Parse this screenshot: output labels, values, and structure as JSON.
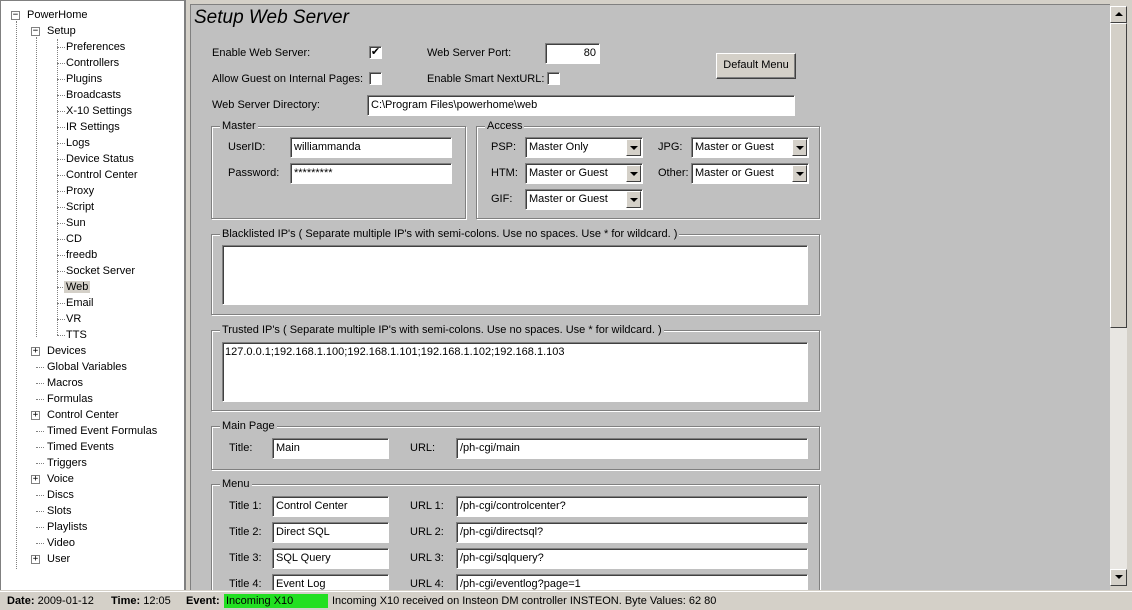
{
  "colors": {
    "event_badge": "#22e022",
    "window_bg": "#d4d0c8",
    "panel_bg": "#c0c0c0"
  },
  "tree": {
    "root": "PowerHome",
    "setup": "Setup",
    "setup_items": [
      "Preferences",
      "Controllers",
      "Plugins",
      "Broadcasts",
      "X-10 Settings",
      "IR Settings",
      "Logs",
      "Device Status",
      "Control Center",
      "Proxy",
      "Script",
      "Sun",
      "CD",
      "freedb",
      "Socket Server",
      "Web",
      "Email",
      "VR",
      "TTS"
    ],
    "selected": "Web",
    "top_items": [
      {
        "label": "Devices",
        "expandable": true
      },
      {
        "label": "Global Variables",
        "expandable": false
      },
      {
        "label": "Macros",
        "expandable": false
      },
      {
        "label": "Formulas",
        "expandable": false
      },
      {
        "label": "Control Center",
        "expandable": true
      },
      {
        "label": "Timed Event Formulas",
        "expandable": false
      },
      {
        "label": "Timed Events",
        "expandable": false
      },
      {
        "label": "Triggers",
        "expandable": false
      },
      {
        "label": "Voice",
        "expandable": true
      },
      {
        "label": "Discs",
        "expandable": false
      },
      {
        "label": "Slots",
        "expandable": false
      },
      {
        "label": "Playlists",
        "expandable": false
      },
      {
        "label": "Video",
        "expandable": false
      },
      {
        "label": "User",
        "expandable": true
      }
    ]
  },
  "page": {
    "title": "Setup Web Server",
    "enable_web_server_label": "Enable Web Server:",
    "enable_web_server_checked": true,
    "web_server_port_label": "Web Server Port:",
    "web_server_port": "80",
    "default_menu_button": "Default Menu",
    "allow_guest_label": "Allow Guest on Internal Pages:",
    "allow_guest_checked": false,
    "enable_smart_label": "Enable Smart NextURL:",
    "enable_smart_checked": false,
    "web_dir_label": "Web Server Directory:",
    "web_dir": "C:\\Program Files\\powerhome\\web",
    "master": {
      "title": "Master",
      "userid_label": "UserID:",
      "userid": "williammanda",
      "password_label": "Password:",
      "password": "*********"
    },
    "access": {
      "title": "Access",
      "psp_label": "PSP:",
      "psp": "Master Only",
      "htm_label": "HTM:",
      "htm": "Master or Guest",
      "gif_label": "GIF:",
      "gif": "Master or Guest",
      "jpg_label": "JPG:",
      "jpg": "Master or Guest",
      "other_label": "Other:",
      "other": "Master or Guest"
    },
    "blacklist": {
      "title": "Blacklisted IP's ( Separate multiple IP's with semi-colons.  Use no spaces.  Use * for wildcard. )",
      "value": ""
    },
    "trusted": {
      "title": "Trusted IP's ( Separate multiple IP's with semi-colons.  Use no spaces.  Use * for wildcard. )",
      "value": "127.0.0.1;192.168.1.100;192.168.1.101;192.168.1.102;192.168.1.103"
    },
    "main_page": {
      "title": "Main Page",
      "title_label": "Title:",
      "title_value": "Main",
      "url_label": "URL:",
      "url_value": "/ph-cgi/main"
    },
    "menu": {
      "title": "Menu",
      "rows": [
        {
          "title_label": "Title 1:",
          "title": "Control Center",
          "url_label": "URL 1:",
          "url": "/ph-cgi/controlcenter?"
        },
        {
          "title_label": "Title 2:",
          "title": "Direct SQL",
          "url_label": "URL 2:",
          "url": "/ph-cgi/directsql?"
        },
        {
          "title_label": "Title 3:",
          "title": "SQL Query",
          "url_label": "URL 3:",
          "url": "/ph-cgi/sqlquery?"
        },
        {
          "title_label": "Title 4:",
          "title": "Event Log",
          "url_label": "URL 4:",
          "url": "/ph-cgi/eventlog?page=1"
        }
      ]
    }
  },
  "status": {
    "date_label": "Date:",
    "date": "2009-01-12",
    "time_label": "Time:",
    "time": "12:05",
    "event_label": "Event:",
    "event": "Incoming X10",
    "message": "Incoming X10 received on Insteon DM controller INSTEON. Byte Values: 62 80"
  }
}
